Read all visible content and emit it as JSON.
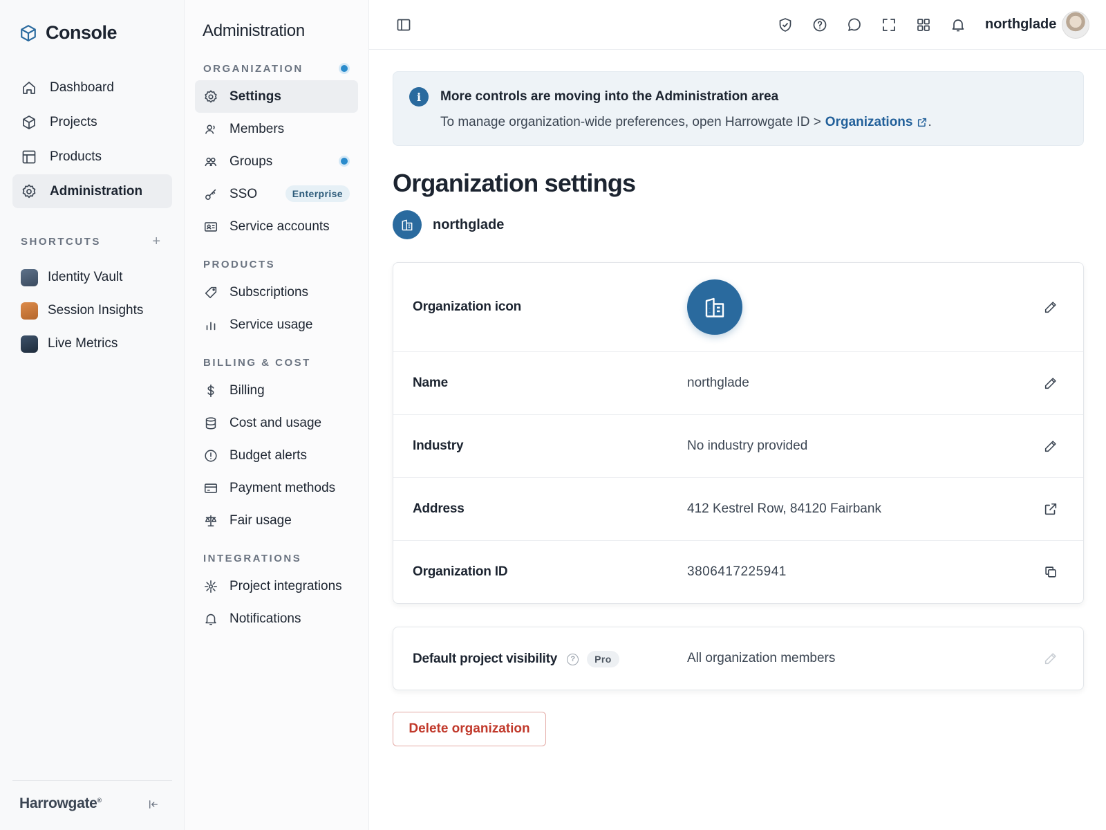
{
  "app": {
    "name": "Console",
    "footer_brand": "Harrowgate"
  },
  "primary_nav": [
    {
      "label": "Dashboard",
      "icon": "home-icon"
    },
    {
      "label": "Projects",
      "icon": "cube-icon"
    },
    {
      "label": "Products",
      "icon": "layout-icon"
    },
    {
      "label": "Administration",
      "icon": "gear-icon",
      "active": true
    }
  ],
  "shortcuts": {
    "label": "SHORTCUTS",
    "add_label": "+",
    "items": [
      {
        "label": "Identity Vault",
        "color": "#4a5c72"
      },
      {
        "label": "Session Insights",
        "color": "#c8783a"
      },
      {
        "label": "Live Metrics",
        "color": "#2c3e52"
      }
    ]
  },
  "secondary": {
    "title": "Administration",
    "groups": {
      "organization": "ORGANIZATION",
      "products": "PRODUCTS",
      "billing": "BILLING & COST",
      "integrations": "INTEGRATIONS"
    },
    "items": {
      "settings": "Settings",
      "members": "Members",
      "groups": "Groups",
      "sso": "SSO",
      "sso_badge": "Enterprise",
      "service_accounts": "Service accounts",
      "subscriptions": "Subscriptions",
      "service_usage": "Service usage",
      "billing": "Billing",
      "cost_usage": "Cost and usage",
      "budget_alerts": "Budget alerts",
      "payment_methods": "Payment methods",
      "fair_usage": "Fair usage",
      "project_integrations": "Project integrations",
      "notifications": "Notifications"
    }
  },
  "topbar": {
    "username": "northglade"
  },
  "banner": {
    "icon_text": "i",
    "title": "More controls are moving into the Administration area",
    "body": "To manage organization-wide preferences, open Harrowgate ID >",
    "link": "Organizations",
    "trailing": "."
  },
  "page": {
    "title": "Organization settings",
    "org_name": "northglade"
  },
  "settings": {
    "icon_label": "Organization icon",
    "name_label": "Name",
    "name_value": "northglade",
    "industry_label": "Industry",
    "industry_value": "No industry provided",
    "address_label": "Address",
    "address_value": "412 Kestrel Row, 84120 Fairbank",
    "id_label": "Organization ID",
    "id_value": "3806417225941",
    "visibility_label": "Default project visibility",
    "visibility_badge": "Pro",
    "visibility_value": "All organization members"
  },
  "actions": {
    "delete": "Delete organization"
  },
  "colors": {
    "accent": "#2a6a9e",
    "danger": "#c1392b",
    "dot": "#2a8bcc"
  }
}
